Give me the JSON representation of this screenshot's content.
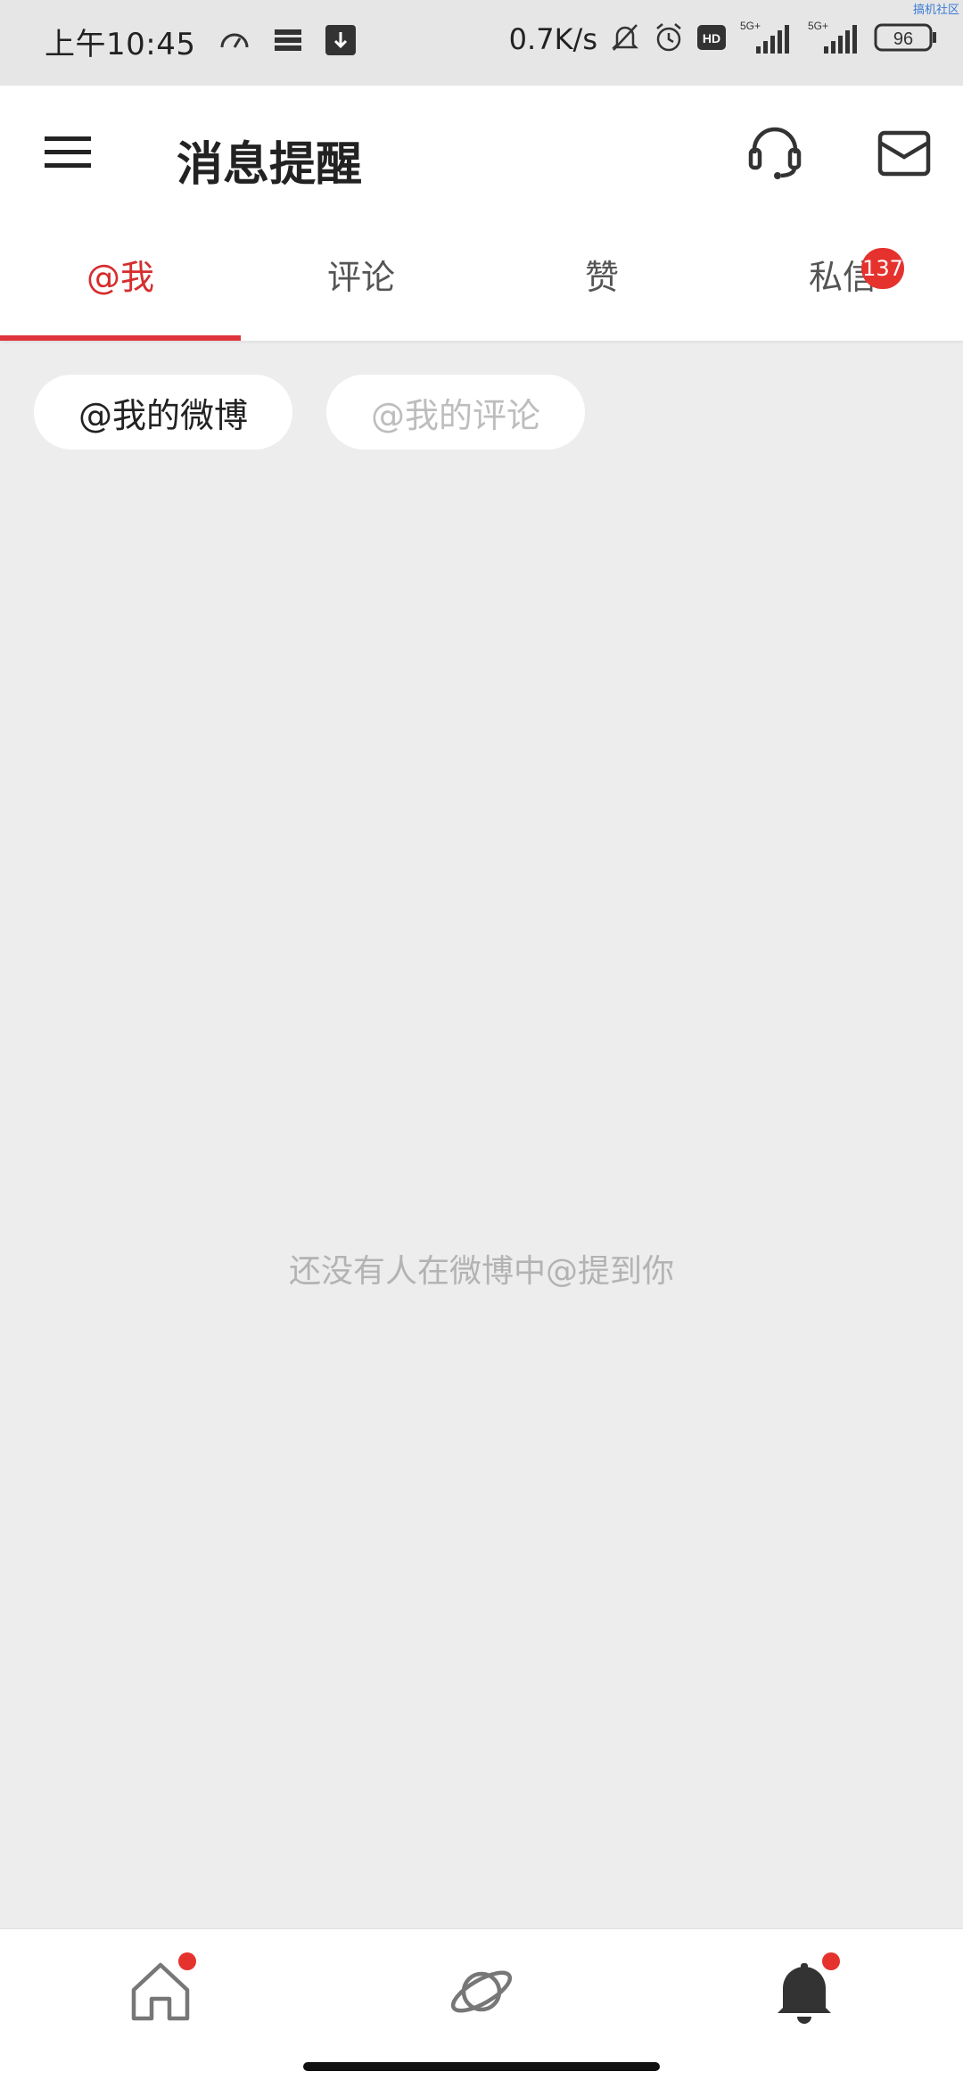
{
  "status_bar": {
    "time": "上午10:45",
    "net_speed": "0.7K/s",
    "hd_label": "HD",
    "sim1_label": "5G+",
    "sim2_label": "5G+",
    "battery": "96",
    "watermark": "搞机社区",
    "icons": [
      "speedometer-icon",
      "storage-icon",
      "download-icon",
      "mute-bell-icon",
      "alarm-icon",
      "hd-icon",
      "signal-icon",
      "signal-icon",
      "battery-icon"
    ]
  },
  "header": {
    "title": "消息提醒",
    "icons": [
      "menu-icon",
      "headset-icon",
      "envelope-icon"
    ]
  },
  "tabs": [
    {
      "label": "@我",
      "active": true
    },
    {
      "label": "评论",
      "active": false
    },
    {
      "label": "赞",
      "active": false
    },
    {
      "label": "私信",
      "active": false,
      "badge": "137"
    }
  ],
  "filters": {
    "mine": "@我的微博",
    "comments": "@我的评论"
  },
  "empty_state": "还没有人在微博中@提到你",
  "bottom_nav": {
    "items": [
      {
        "icon": "home-icon",
        "has_dot": true
      },
      {
        "icon": "planet-icon",
        "has_dot": false
      },
      {
        "icon": "bell-icon",
        "has_dot": true
      }
    ]
  },
  "colors": {
    "accent": "#e0333a",
    "badge": "#e5322d",
    "background": "#ededed"
  }
}
